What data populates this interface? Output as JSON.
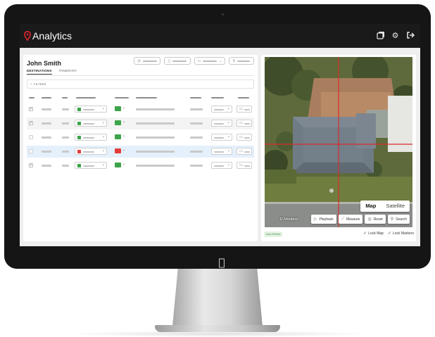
{
  "app": {
    "title": "Analytics",
    "brand_color": "#e3262c",
    "topbar_icons": [
      "layers-icon",
      "gear-icon",
      "logout-icon"
    ]
  },
  "left_panel": {
    "user_name": "John Smith",
    "tabs": [
      {
        "label": "DESTINATIONS",
        "active": true
      },
      {
        "label": "ITINERARY",
        "active": false
      }
    ],
    "controls": [
      "clock-icon",
      "document-icon",
      "folder-icon",
      "pin-icon"
    ],
    "filters_label": "FILTERS",
    "rows": [
      {
        "checked": true,
        "color": "#3ca44a",
        "flag": "#3ca44a",
        "style": "plain"
      },
      {
        "checked": true,
        "color": "#3ca44a",
        "flag": "#3ca44a",
        "style": "alt"
      },
      {
        "checked": false,
        "color": "#3ca44a",
        "flag": "#3ca44a",
        "style": "plain"
      },
      {
        "checked": false,
        "color": "#e23b3b",
        "flag": "#e23b3b",
        "style": "selected"
      },
      {
        "checked": true,
        "color": "#3ca44a",
        "flag": "#3ca44a",
        "style": "plain"
      }
    ]
  },
  "map": {
    "type_options": [
      {
        "label": "Map",
        "active": true
      },
      {
        "label": "Satellite",
        "active": false
      }
    ],
    "street_label": "E Montero",
    "tools": [
      {
        "icon": "play-icon",
        "label": "Playback"
      },
      {
        "icon": "ruler-icon",
        "label": "Measure"
      },
      {
        "icon": "reset-icon",
        "label": "Reset"
      },
      {
        "icon": "search-icon",
        "label": "Search"
      }
    ],
    "crosshair_color": "#d92b2b"
  },
  "footer": {
    "badge": "Auto Refresh",
    "lock_map": "Lock Map",
    "lock_markers": "Lock Markers"
  }
}
